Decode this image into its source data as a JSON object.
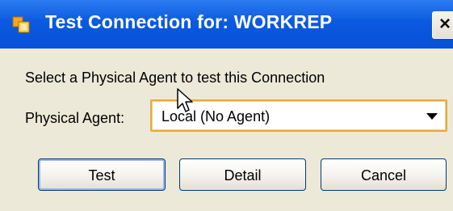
{
  "window": {
    "title": "Test Connection for: WORKREP",
    "title_icon": "odi-connection-icon",
    "close_label": "×"
  },
  "body": {
    "prompt": "Select a Physical Agent to test this Connection",
    "agent_label": "Physical Agent:",
    "agent_value": "Local (No Agent)"
  },
  "buttons": {
    "test": "Test",
    "detail": "Detail",
    "cancel": "Cancel"
  },
  "colors": {
    "titlebar": "#0a5ae0",
    "dialog_bg": "#ece9d8",
    "focus_border": "#e8a940"
  }
}
